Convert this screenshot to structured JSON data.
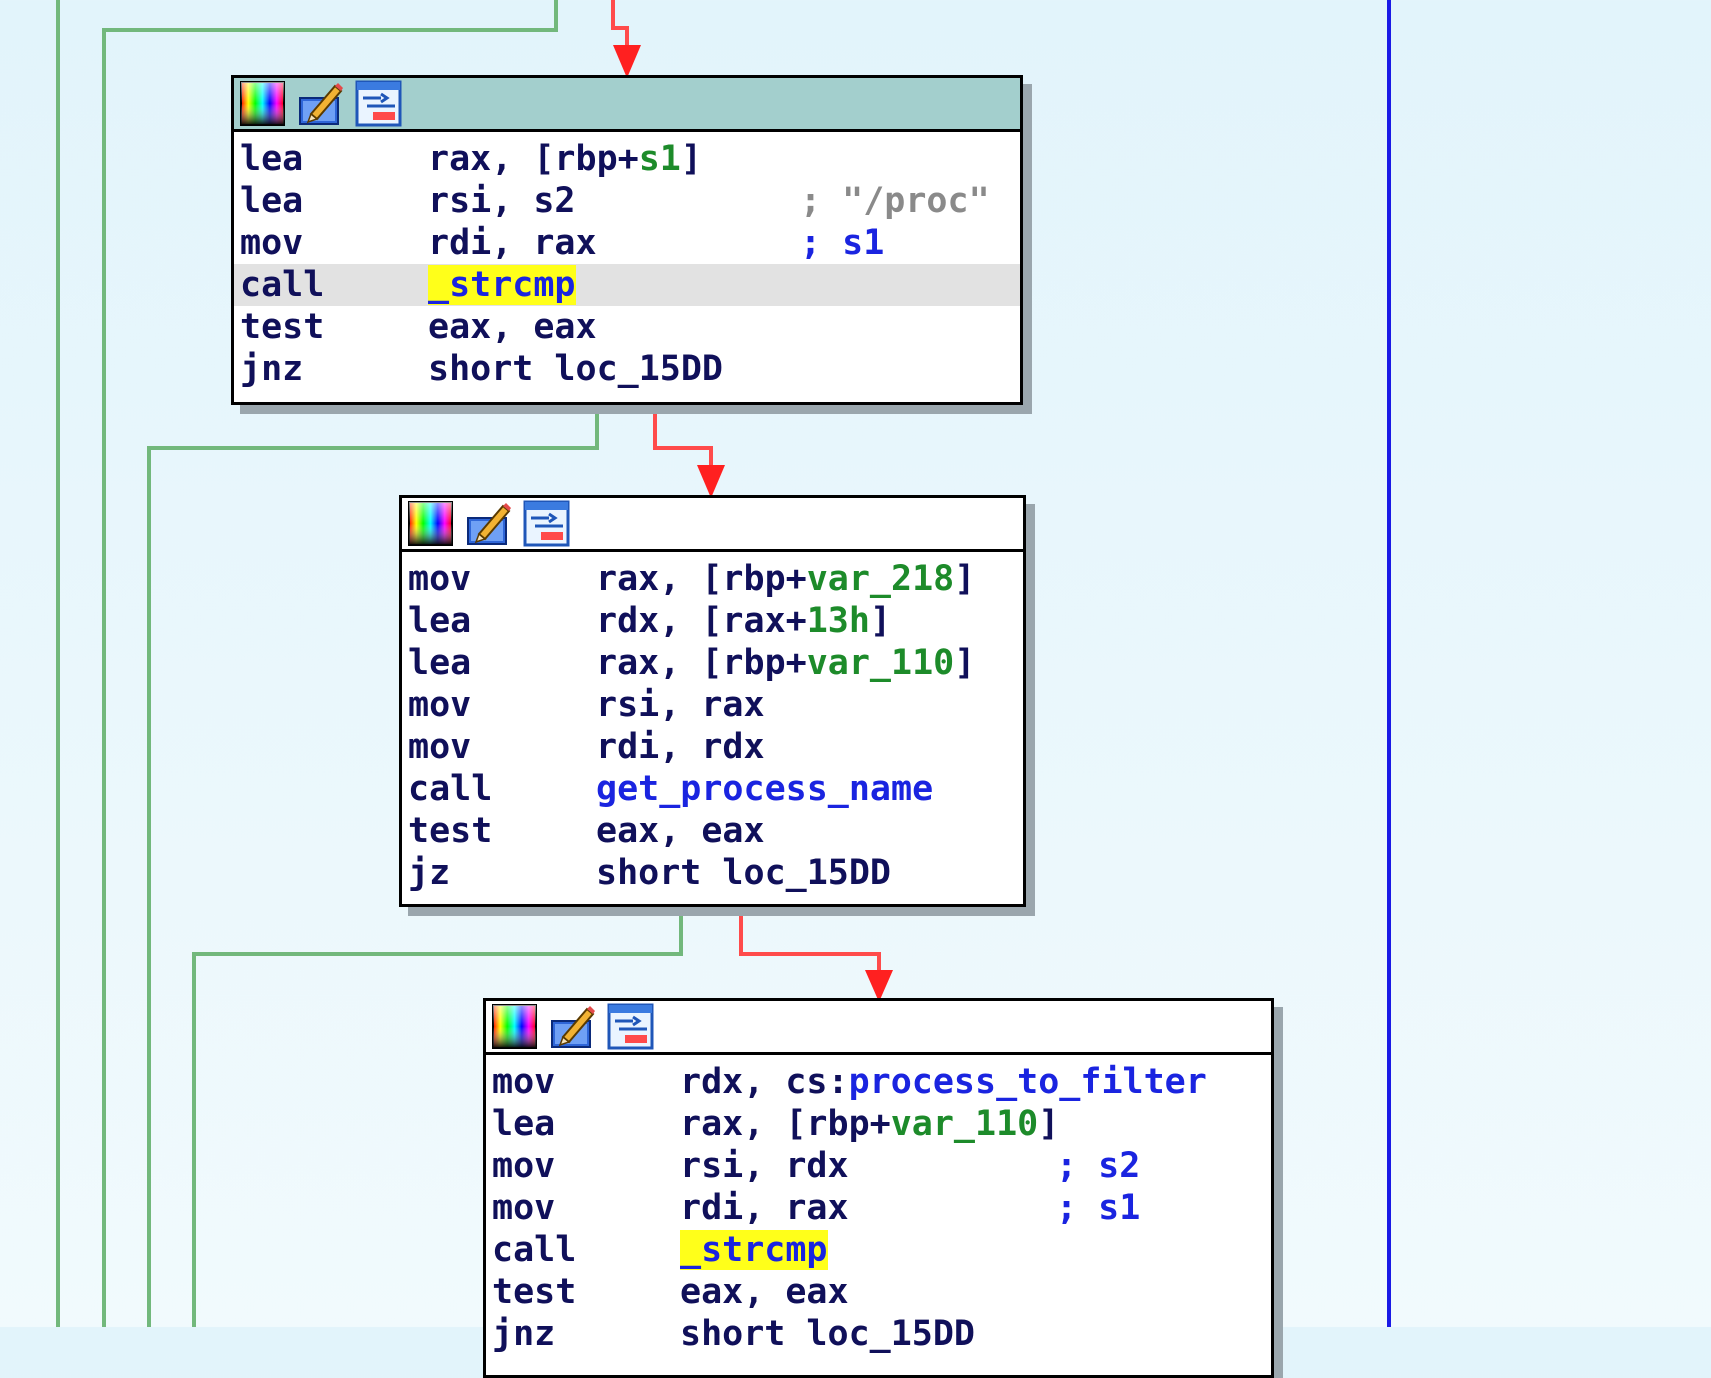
{
  "colors": {
    "background": "#e8f6fb",
    "header_active": "#a3cfcd",
    "edge_true": "#ff3b3b",
    "edge_false": "#72b87c",
    "edge_jump": "#1a1ae6",
    "operand_blue": "#1a24e0",
    "operand_green": "#1d8b2a",
    "comment_gray": "#8a8a8a",
    "highlight": "#ffff1a",
    "mnemonic": "#10105a"
  },
  "header_icons": [
    "palette-icon",
    "rename-pencil-icon",
    "graph-overview-icon"
  ],
  "blocks": [
    {
      "name": "block-1",
      "lines": [
        {
          "mn": "lea",
          "ops": [
            {
              "t": "rax, [rbp+"
            },
            {
              "t": "s1",
              "c": "green"
            },
            {
              "t": "]"
            }
          ]
        },
        {
          "mn": "lea",
          "ops": [
            {
              "t": "rsi, s2"
            }
          ],
          "comment": [
            {
              "t": "; \"/proc\"",
              "c": "gray"
            }
          ]
        },
        {
          "mn": "mov",
          "ops": [
            {
              "t": "rdi, rax"
            }
          ],
          "comment": [
            {
              "t": "; s1",
              "c": "blue"
            }
          ]
        },
        {
          "mn": "call",
          "ops": [
            {
              "t": "_strcmp",
              "c": "blue",
              "hl": true
            }
          ],
          "current": true
        },
        {
          "mn": "test",
          "ops": [
            {
              "t": "eax, eax"
            }
          ]
        },
        {
          "mn": "jnz",
          "ops": [
            {
              "t": "short loc_15DD"
            }
          ]
        }
      ]
    },
    {
      "name": "block-2",
      "lines": [
        {
          "mn": "mov",
          "ops": [
            {
              "t": "rax, [rbp+"
            },
            {
              "t": "var_218",
              "c": "green"
            },
            {
              "t": "]"
            }
          ]
        },
        {
          "mn": "lea",
          "ops": [
            {
              "t": "rdx, [rax+"
            },
            {
              "t": "13h",
              "c": "green"
            },
            {
              "t": "]"
            }
          ]
        },
        {
          "mn": "lea",
          "ops": [
            {
              "t": "rax, [rbp+"
            },
            {
              "t": "var_110",
              "c": "green"
            },
            {
              "t": "]"
            }
          ]
        },
        {
          "mn": "mov",
          "ops": [
            {
              "t": "rsi, rax"
            }
          ]
        },
        {
          "mn": "mov",
          "ops": [
            {
              "t": "rdi, rdx"
            }
          ]
        },
        {
          "mn": "call",
          "ops": [
            {
              "t": "get_process_name",
              "c": "blue"
            }
          ]
        },
        {
          "mn": "test",
          "ops": [
            {
              "t": "eax, eax"
            }
          ]
        },
        {
          "mn": "jz",
          "ops": [
            {
              "t": "short loc_15DD"
            }
          ]
        }
      ]
    },
    {
      "name": "block-3",
      "lines": [
        {
          "mn": "mov",
          "ops": [
            {
              "t": "rdx, cs:"
            },
            {
              "t": "process_to_filter",
              "c": "blue"
            }
          ]
        },
        {
          "mn": "lea",
          "ops": [
            {
              "t": "rax, [rbp+"
            },
            {
              "t": "var_110",
              "c": "green"
            },
            {
              "t": "]"
            }
          ]
        },
        {
          "mn": "mov",
          "ops": [
            {
              "t": "rsi, rdx"
            }
          ],
          "comment": [
            {
              "t": "; s2",
              "c": "blue"
            }
          ]
        },
        {
          "mn": "mov",
          "ops": [
            {
              "t": "rdi, rax"
            }
          ],
          "comment": [
            {
              "t": "; s1",
              "c": "blue"
            }
          ]
        },
        {
          "mn": "call",
          "ops": [
            {
              "t": "_strcmp",
              "c": "blue",
              "hl": true
            }
          ]
        },
        {
          "mn": "test",
          "ops": [
            {
              "t": "eax, eax"
            }
          ]
        },
        {
          "mn": "jnz",
          "ops": [
            {
              "t": "short loc_15DD"
            }
          ]
        }
      ]
    }
  ]
}
